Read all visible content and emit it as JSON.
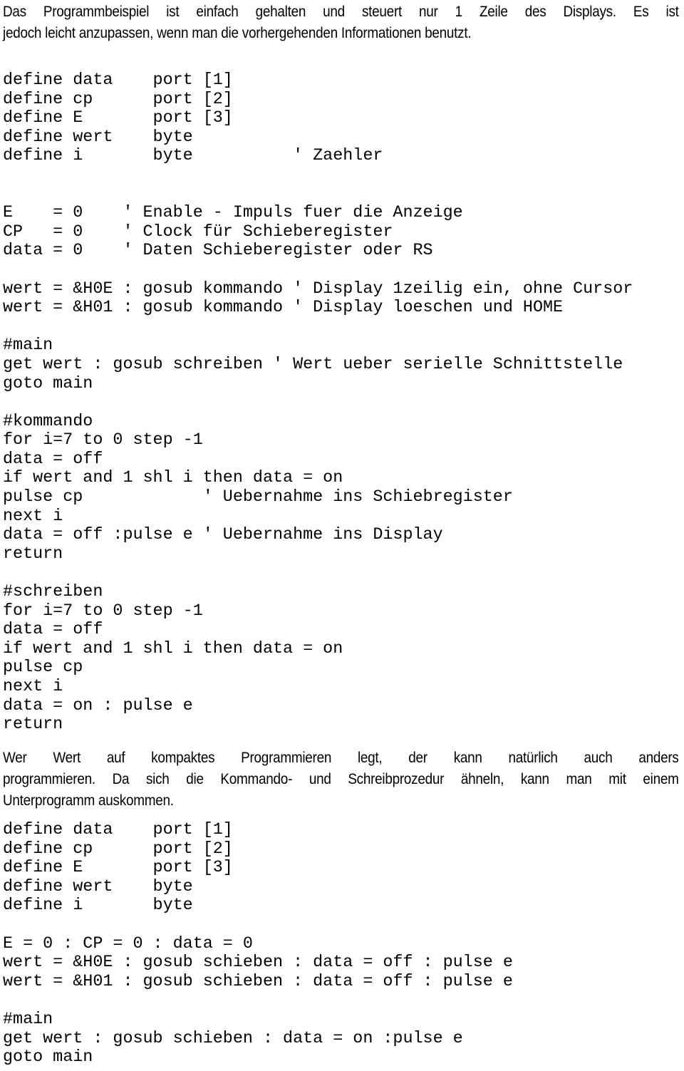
{
  "document": {
    "language": "de",
    "text_color": "#000000",
    "background_color": "#ffffff"
  },
  "intro_paragraph": {
    "line1": "Das Programmbeispiel ist einfach gehalten und steuert nur 1 Zeile des Displays. Es ist",
    "line2": "jedoch leicht anzupassen, wenn man die vorhergehenden Informationen benutzt."
  },
  "mid_paragraph": {
    "line1": "Wer Wert auf kompaktes Programmieren legt, der kann natürlich auch anders",
    "line2": "programmieren. Da sich die Kommando- und Schreibprozedur ähneln, kann man mit einem",
    "line3": "Unterprogramm auskommen."
  },
  "code_block_1": {
    "lines": [
      "define data    port [1]",
      "define cp      port [2]",
      "define E       port [3]",
      "define wert    byte",
      "define i       byte          ' Zaehler",
      "",
      "",
      "E    = 0    ' Enable - Impuls fuer die Anzeige",
      "CP   = 0    ' Clock für Schieberegister",
      "data = 0    ' Daten Schieberegister oder RS",
      "",
      "wert = &H0E : gosub kommando ' Display 1zeilig ein, ohne Cursor",
      "wert = &H01 : gosub kommando ' Display loeschen und HOME",
      "",
      "#main",
      "get wert : gosub schreiben ' Wert ueber serielle Schnittstelle",
      "goto main",
      "",
      "#kommando",
      "for i=7 to 0 step -1",
      "data = off",
      "if wert and 1 shl i then data = on",
      "pulse cp            ' Uebernahme ins Schiebregister",
      "next i",
      "data = off :pulse e ' Uebernahme ins Display",
      "return",
      "",
      "#schreiben",
      "for i=7 to 0 step -1",
      "data = off",
      "if wert and 1 shl i then data = on",
      "pulse cp",
      "next i",
      "data = on : pulse e",
      "return"
    ]
  },
  "code_block_2": {
    "lines": [
      "define data    port [1]",
      "define cp      port [2]",
      "define E       port [3]",
      "define wert    byte",
      "define i       byte",
      "",
      "E = 0 : CP = 0 : data = 0",
      "wert = &H0E : gosub schieben : data = off : pulse e",
      "wert = &H01 : gosub schieben : data = off : pulse e",
      "",
      "#main",
      "get wert : gosub schieben : data = on :pulse e",
      "goto main"
    ]
  }
}
